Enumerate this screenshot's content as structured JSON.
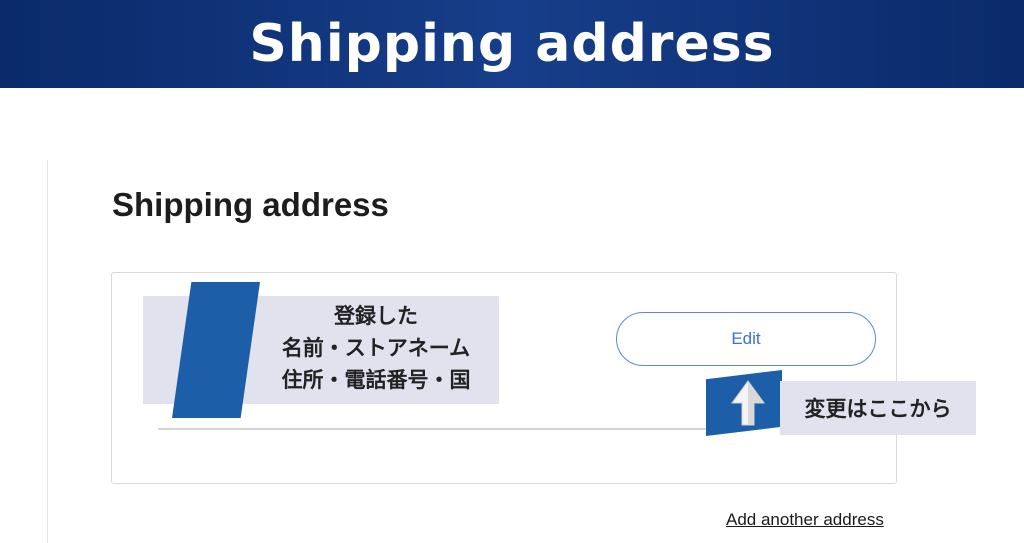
{
  "banner": {
    "title": "Shipping address"
  },
  "section": {
    "heading": "Shipping address"
  },
  "card": {
    "edit_label": "Edit"
  },
  "annotation": {
    "lines": [
      "登録した",
      "名前・ストアネーム",
      "住所・電話番号・国"
    ]
  },
  "hint": {
    "text": "変更はここから",
    "icon": "cursor-arrow-icon"
  },
  "links": {
    "add_address": "Add another address"
  },
  "colors": {
    "banner": "#173e8a",
    "accent": "#1c5ea8",
    "note_bg": "#e1e2ee",
    "button_border": "#5a86e6",
    "button_text": "#3b6fe0"
  }
}
